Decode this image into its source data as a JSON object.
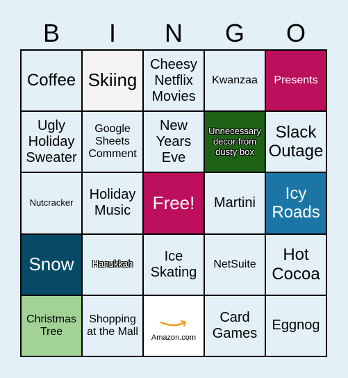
{
  "header": [
    "B",
    "I",
    "N",
    "G",
    "O"
  ],
  "cells": [
    {
      "text": "Coffee",
      "bg": "#e3f0f7",
      "color": "#000000",
      "size": "f24"
    },
    {
      "text": "Skiing",
      "bg": "#f4f4f4",
      "color": "#000000",
      "size": "f26"
    },
    {
      "text": "Cheesy Netflix Movies",
      "bg": "#e3f0f7",
      "color": "#000000",
      "size": "f20"
    },
    {
      "text": "Kwanzaa",
      "bg": "#e3f0f7",
      "color": "#000000",
      "size": "f16"
    },
    {
      "text": "Presents",
      "bg": "#bc0f5c",
      "color": "#ffffff",
      "size": "f16"
    },
    {
      "text": "Ugly Holiday Sweater",
      "bg": "#e3f0f7",
      "color": "#000000",
      "size": "f20"
    },
    {
      "text": "Google Sheets Comment",
      "bg": "#e3f0f7",
      "color": "#000000",
      "size": "f16"
    },
    {
      "text": "New Years Eve",
      "bg": "#e3f0f7",
      "color": "#000000",
      "size": "f20"
    },
    {
      "text": "Unnecessary decor from dusty box",
      "bg": "#1e6315",
      "color": "#ffffff",
      "size": "f13",
      "outline": true
    },
    {
      "text": "Slack Outage",
      "bg": "#e3f0f7",
      "color": "#000000",
      "size": "f24"
    },
    {
      "text": "Nutcracker",
      "bg": "#e3f0f7",
      "color": "#000000",
      "size": "f13"
    },
    {
      "text": "Holiday Music",
      "bg": "#e3f0f7",
      "color": "#000000",
      "size": "f20"
    },
    {
      "text": "Free!",
      "bg": "#bc0f5c",
      "color": "#ffffff",
      "size": "f26"
    },
    {
      "text": "Martini",
      "bg": "#e3f0f7",
      "color": "#000000",
      "size": "f20"
    },
    {
      "text": "Icy Roads",
      "bg": "#1b76a5",
      "color": "#ffffff",
      "size": "f24"
    },
    {
      "text": "Snow",
      "bg": "#064a68",
      "color": "#ffffff",
      "size": "f26"
    },
    {
      "text": "Hanukkah",
      "bg": "#e3f0f7",
      "color": "#ffffff",
      "size": "f13",
      "outline": true
    },
    {
      "text": "Ice Skating",
      "bg": "#e3f0f7",
      "color": "#000000",
      "size": "f20"
    },
    {
      "text": "NetSuite",
      "bg": "#e3f0f7",
      "color": "#000000",
      "size": "f16"
    },
    {
      "text": "Hot Cocoa",
      "bg": "#e3f0f7",
      "color": "#000000",
      "size": "f24"
    },
    {
      "text": "Christmas Tree",
      "bg": "#a2d296",
      "color": "#000000",
      "size": "f16"
    },
    {
      "text": "Shopping at the Mall",
      "bg": "#e3f0f7",
      "color": "#000000",
      "size": "f16"
    },
    {
      "text": "Amazon.com",
      "bg": "#ffffff",
      "color": "#000000",
      "size": "f11",
      "image": "amazon-smile"
    },
    {
      "text": "Card Games",
      "bg": "#e3f0f7",
      "color": "#000000",
      "size": "f20"
    },
    {
      "text": "Eggnog",
      "bg": "#e3f0f7",
      "color": "#000000",
      "size": "f20"
    }
  ]
}
